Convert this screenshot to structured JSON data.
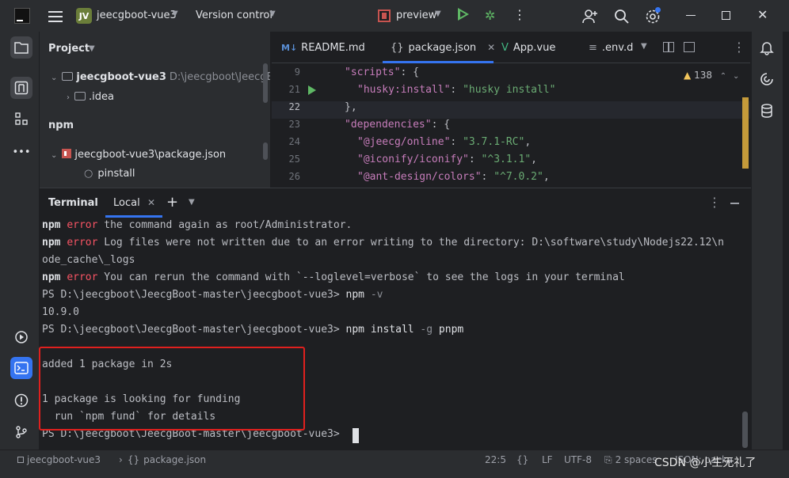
{
  "titlebar": {
    "project_badge": "JV",
    "project_name": "jeecgboot-vue3",
    "vcs": "Version control",
    "run_config": "preview"
  },
  "project_panel": {
    "title": "Project",
    "root_name": "jeecgboot-vue3",
    "root_path": "D:\\jeecgboot\\JeecgBoo",
    "idea": ".idea",
    "npm_title": "npm",
    "npm_package": "jeecgboot-vue3\\package.json",
    "npm_script": "pinstall"
  },
  "editor": {
    "tabs": [
      {
        "icon": "M↓",
        "label": "README.md"
      },
      {
        "icon": "{}",
        "label": "package.json"
      },
      {
        "icon": "V",
        "label": "App.vue"
      },
      {
        "icon": "≡",
        "label": ".env.d"
      }
    ],
    "warnings": "138",
    "line_numbers": [
      "9",
      "21",
      "22",
      "23",
      "24",
      "25",
      "26"
    ],
    "lines": [
      {
        "k": "\"scripts\"",
        "p": ": {",
        "s": ""
      },
      {
        "k": "\"husky:install\"",
        "p": ": ",
        "s": "\"husky install\""
      },
      {
        "k": "",
        "p": "},",
        "s": ""
      },
      {
        "k": "\"dependencies\"",
        "p": ": {",
        "s": ""
      },
      {
        "k": "\"@jeecg/online\"",
        "p": ": ",
        "s": "\"3.7.1-RC\"",
        "tail": ","
      },
      {
        "k": "\"@iconify/iconify\"",
        "p": ": ",
        "s": "\"^3.1.1\"",
        "tail": ","
      },
      {
        "k": "\"@ant-design/colors\"",
        "p": ": ",
        "s": "\"^7.0.2\"",
        "tail": ","
      }
    ]
  },
  "terminal": {
    "title": "Terminal",
    "tab": "Local",
    "lines": {
      "l1_npm": "npm",
      "l1_err": "error",
      "l1_rest": " the command again as root/Administrator.",
      "l2_npm": "npm",
      "l2_err": "error",
      "l2_rest": " Log files were not written due to an error writing to the directory: D:\\software\\study\\Nodejs22.12\\n",
      "l3": "ode_cache\\_logs",
      "l4_npm": "npm",
      "l4_err": "error",
      "l4_rest": " You can rerun the command with `--loglevel=verbose` to see the logs in your terminal",
      "l5_prompt": "PS D:\\jeecgboot\\JeecgBoot-master\\jeecgboot-vue3> ",
      "l5_cmd": "npm",
      "l5_flag": " -v",
      "l6": "10.9.0",
      "l7_prompt": "PS D:\\jeecgboot\\JeecgBoot-master\\jeecgboot-vue3> ",
      "l7_cmd": "npm install",
      "l7_flag": " -g",
      "l7_arg": " pnpm",
      "l8": "added 1 package in 2s",
      "l9": "1 package is looking for funding",
      "l10": "  run `npm fund` for details",
      "l11_prompt": "PS D:\\jeecgboot\\JeecgBoot-master\\jeecgboot-vue3> "
    }
  },
  "statusbar": {
    "module": "jeecgboot-vue3",
    "file": "package.json",
    "position": "22:5",
    "format": "{}",
    "line_sep": "LF",
    "encoding": "UTF-8",
    "indent": "2 spaces",
    "schema": "JSON: packa"
  },
  "watermark": "CSDN @小生无礼了"
}
